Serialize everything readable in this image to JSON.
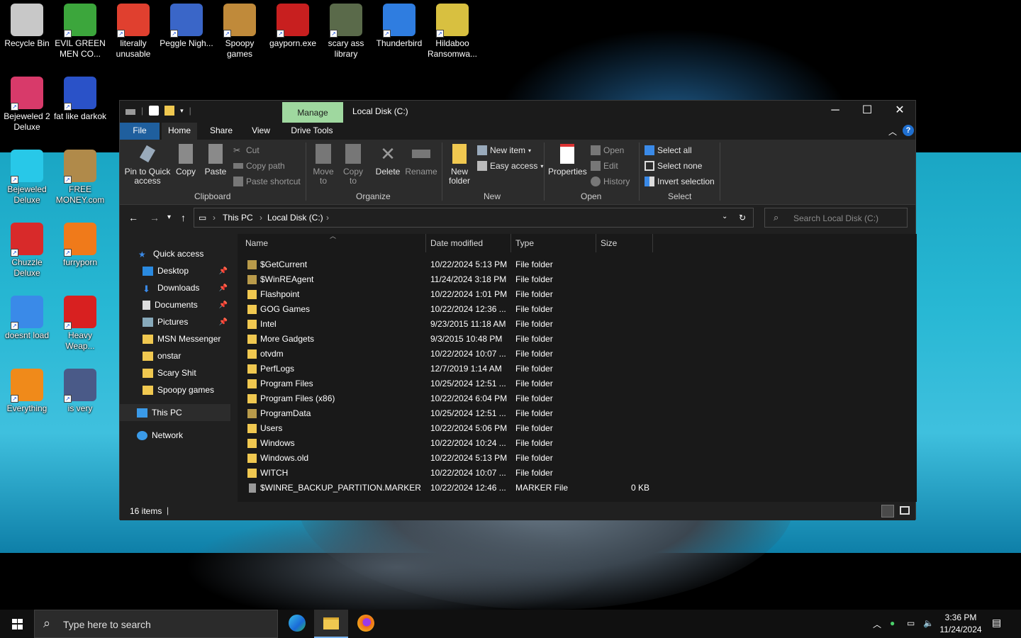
{
  "desktop": {
    "icons": [
      {
        "label": "Recycle Bin",
        "icon": "recycle-bin-icon",
        "color": "#c8c8c8"
      },
      {
        "label": "EVIL GREEN MEN CO...",
        "icon": "green-men-icon",
        "color": "#3ca63c"
      },
      {
        "label": "literally unusable",
        "icon": "chrome-icon",
        "color": "#e0402f"
      },
      {
        "label": "Peggle Nigh...",
        "icon": "peggle-icon",
        "color": "#3a66c8"
      },
      {
        "label": "Spoopy games",
        "icon": "folder-icon",
        "color": "#c08a3a"
      },
      {
        "label": "gayporn.exe",
        "icon": "flash-icon",
        "color": "#c81f1f"
      },
      {
        "label": "scary ass library",
        "icon": "library-icon",
        "color": "#5a6a4a"
      },
      {
        "label": "Thunderbird",
        "icon": "thunderbird-icon",
        "color": "#2f7de0"
      },
      {
        "label": "Hildaboo Ransomwa...",
        "icon": "ransomware-icon",
        "color": "#d8c040"
      },
      {
        "label": "Bejeweled 2 Deluxe",
        "icon": "bejeweled2-icon",
        "color": "#d83a6a"
      },
      {
        "label": "fat like darkok",
        "icon": "mpl-icon",
        "color": "#2a52c8"
      },
      {
        "label": "Bejeweled Deluxe",
        "icon": "diamond-icon",
        "color": "#28c8e8"
      },
      {
        "label": "FREE MONEY.com",
        "icon": "money-bag-icon",
        "color": "#b08a4a"
      },
      {
        "label": "Chuzzle Deluxe",
        "icon": "chuzzle-icon",
        "color": "#d82a2a"
      },
      {
        "label": "furryporn",
        "icon": "firefox-icon",
        "color": "#f07a1a"
      },
      {
        "label": "doesnt load",
        "icon": "thunderbird-icon",
        "color": "#3a8ae8"
      },
      {
        "label": "Heavy Weap...",
        "icon": "radiation-icon",
        "color": "#d82020"
      },
      {
        "label": "Everything",
        "icon": "magnifier-icon",
        "color": "#f08a1a"
      },
      {
        "label": "is very",
        "icon": "shield-icon",
        "color": "#4a5a88"
      }
    ]
  },
  "explorer": {
    "title": "Local Disk (C:)",
    "manage_tab": "Manage",
    "buttons": {
      "minimize": "─",
      "maximize": "☐",
      "close": "✕"
    },
    "tabs": {
      "file": "File",
      "home": "Home",
      "share": "Share",
      "view": "View",
      "drive_tools": "Drive Tools"
    },
    "ribbon": {
      "pin_label": "Pin to Quick access",
      "copy_label": "Copy",
      "paste_label": "Paste",
      "cut_label": "Cut",
      "copy_path_label": "Copy path",
      "paste_shortcut_label": "Paste shortcut",
      "clipboard_group": "Clipboard",
      "move_to_label": "Move to",
      "copy_to_label": "Copy to",
      "delete_label": "Delete",
      "rename_label": "Rename",
      "organize_group": "Organize",
      "new_folder_label": "New folder",
      "new_item_label": "New item",
      "easy_access_label": "Easy access",
      "new_group": "New",
      "properties_label": "Properties",
      "open_label": "Open",
      "edit_label": "Edit",
      "history_label": "History",
      "open_group": "Open",
      "select_all_label": "Select all",
      "select_none_label": "Select none",
      "invert_selection_label": "Invert selection",
      "select_group": "Select"
    },
    "address": {
      "crumb1": "This PC",
      "crumb2": "Local Disk (C:)"
    },
    "search": {
      "placeholder": "Search Local Disk (C:)"
    },
    "nav": {
      "quick_access": "Quick access",
      "desktop": "Desktop",
      "downloads": "Downloads",
      "documents": "Documents",
      "pictures": "Pictures",
      "msn": "MSN Messenger",
      "onstar": "onstar",
      "scary": "Scary Shit",
      "spoopy": "Spoopy games",
      "this_pc": "This PC",
      "network": "Network"
    },
    "columns": {
      "name": "Name",
      "date": "Date modified",
      "type": "Type",
      "size": "Size"
    },
    "files": [
      {
        "name": "$GetCurrent",
        "date": "10/22/2024 5:13 PM",
        "type": "File folder",
        "size": "",
        "dim": true
      },
      {
        "name": "$WinREAgent",
        "date": "11/24/2024 3:18 PM",
        "type": "File folder",
        "size": "",
        "dim": true
      },
      {
        "name": "Flashpoint",
        "date": "10/22/2024 1:01 PM",
        "type": "File folder",
        "size": "",
        "dim": false
      },
      {
        "name": "GOG Games",
        "date": "10/22/2024 12:36 ...",
        "type": "File folder",
        "size": "",
        "dim": false
      },
      {
        "name": "Intel",
        "date": "9/23/2015 11:18 AM",
        "type": "File folder",
        "size": "",
        "dim": false
      },
      {
        "name": "More Gadgets",
        "date": "9/3/2015 10:48 PM",
        "type": "File folder",
        "size": "",
        "dim": false
      },
      {
        "name": "otvdm",
        "date": "10/22/2024 10:07 ...",
        "type": "File folder",
        "size": "",
        "dim": false
      },
      {
        "name": "PerfLogs",
        "date": "12/7/2019 1:14 AM",
        "type": "File folder",
        "size": "",
        "dim": false
      },
      {
        "name": "Program Files",
        "date": "10/25/2024 12:51 ...",
        "type": "File folder",
        "size": "",
        "dim": false
      },
      {
        "name": "Program Files (x86)",
        "date": "10/22/2024 6:04 PM",
        "type": "File folder",
        "size": "",
        "dim": false
      },
      {
        "name": "ProgramData",
        "date": "10/25/2024 12:51 ...",
        "type": "File folder",
        "size": "",
        "dim": true
      },
      {
        "name": "Users",
        "date": "10/22/2024 5:06 PM",
        "type": "File folder",
        "size": "",
        "dim": false
      },
      {
        "name": "Windows",
        "date": "10/22/2024 10:24 ...",
        "type": "File folder",
        "size": "",
        "dim": false
      },
      {
        "name": "Windows.old",
        "date": "10/22/2024 5:13 PM",
        "type": "File folder",
        "size": "",
        "dim": false
      },
      {
        "name": "WITCH",
        "date": "10/22/2024 10:07 ...",
        "type": "File folder",
        "size": "",
        "dim": false
      },
      {
        "name": "$WINRE_BACKUP_PARTITION.MARKER",
        "date": "10/22/2024 12:46 ...",
        "type": "MARKER File",
        "size": "0 KB",
        "dim": true
      }
    ],
    "status": {
      "count": "16 items"
    }
  },
  "taskbar": {
    "search_placeholder": "Type here to search",
    "time": "3:36 PM",
    "date": "11/24/2024"
  },
  "colors": {
    "accent": "#1f5f9e",
    "manage": "#9fd89f",
    "folder": "#f0c850"
  }
}
